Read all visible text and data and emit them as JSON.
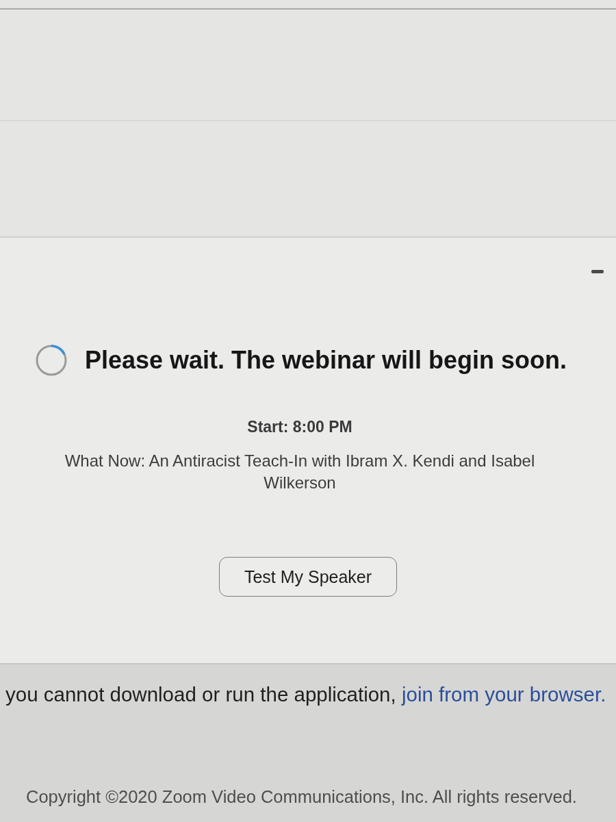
{
  "waiting_dialog": {
    "status": "Please wait. The webinar will begin soon.",
    "start_time": "Start: 8:00 PM",
    "topic": "What Now: An Antiracist Teach-In with Ibram X. Kendi and Isabel Wilkerson",
    "buttons": [
      {
        "label": "Test My Speaker"
      }
    ]
  },
  "browser_page": {
    "notice": {
      "text": "you cannot download or run the application,",
      "link": "join from your browser."
    },
    "copyright": "Copyright ©2020 Zoom Video Communications, Inc. All rights reserved."
  }
}
